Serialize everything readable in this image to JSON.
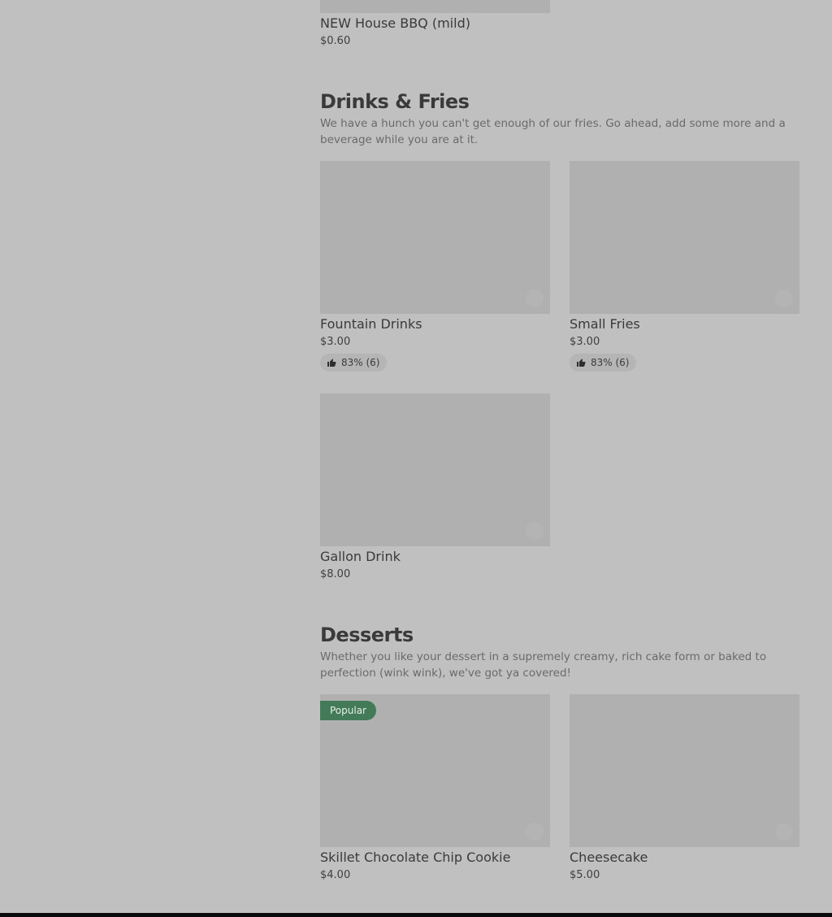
{
  "top_item": {
    "name": "NEW House BBQ (mild)",
    "price": "$0.60"
  },
  "sections": [
    {
      "title": "Drinks & Fries",
      "description": "We have a hunch you can't get enough of our fries. Go ahead, add some more and a beverage while you are at it.",
      "items": [
        {
          "name": "Fountain Drinks",
          "price": "$3.00",
          "rating": "83% (6)"
        },
        {
          "name": "Small Fries",
          "price": "$3.00",
          "rating": "83% (6)"
        },
        {
          "name": "Gallon Drink",
          "price": "$8.00"
        }
      ]
    },
    {
      "title": "Desserts",
      "description": "Whether you like your dessert in a supremely creamy, rich cake form or baked to perfection (wink wink), we've got ya covered!",
      "items": [
        {
          "name": "Skillet Chocolate Chip Cookie",
          "price": "$4.00",
          "badge": "Popular"
        },
        {
          "name": "Cheesecake",
          "price": "$5.00"
        }
      ]
    }
  ],
  "icons": {
    "rating": "thumbs-up-icon"
  },
  "colors": {
    "overlay_bg": "#c0c0c0",
    "badge_bg": "#437a58"
  }
}
